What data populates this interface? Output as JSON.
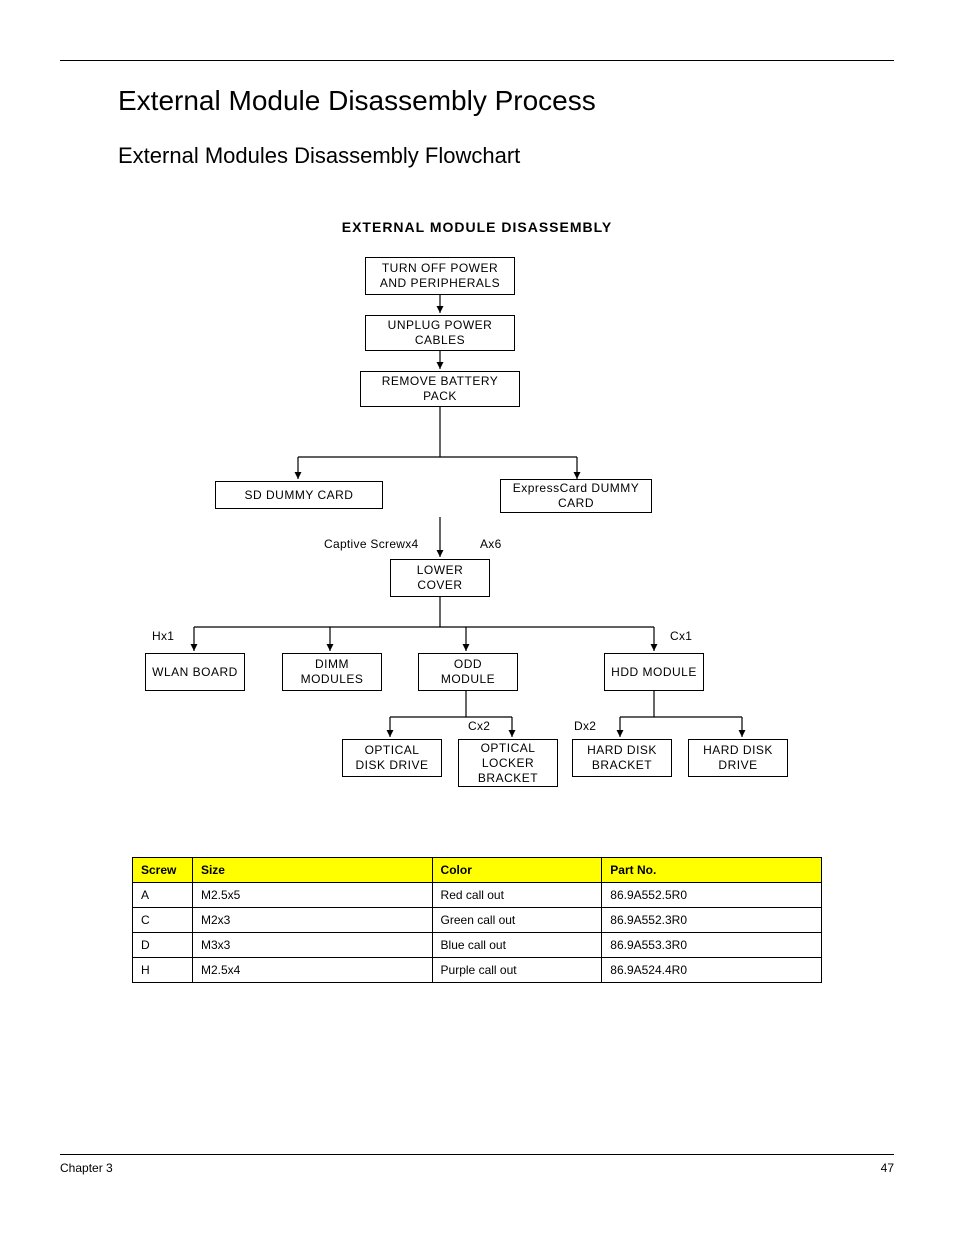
{
  "header": {
    "title": "External Module Disassembly Process",
    "subtitle": "External Modules Disassembly Flowchart"
  },
  "diagram": {
    "title": "EXTERNAL MODULE DISASSEMBLY",
    "boxes": {
      "power_off": "TURN OFF POWER AND PERIPHERALS",
      "unplug": "UNPLUG POWER CABLES",
      "battery": "REMOVE BATTERY PACK",
      "sd_dummy": "SD DUMMY CARD",
      "express_dummy": "ExpressCard DUMMY CARD",
      "lower_cover": "LOWER COVER",
      "wlan": "WLAN BOARD",
      "dimm": "DIMM MODULES",
      "odd_module": "ODD MODULE",
      "hdd_module": "HDD MODULE",
      "optical_drive": "OPTICAL DISK DRIVE",
      "optical_bracket": "OPTICAL LOCKER BRACKET",
      "hdd_bracket": "HARD DISK BRACKET",
      "hdd_drive": "HARD DISK DRIVE"
    },
    "labels": {
      "captive": "Captive Screwx4",
      "ax6": "Ax6",
      "hx1": "Hx1",
      "cx1": "Cx1",
      "cx2": "Cx2",
      "dx2": "Dx2"
    }
  },
  "table": {
    "headers": {
      "screw": "Screw",
      "size": "Size",
      "color": "Color",
      "part": "Part No."
    },
    "rows": [
      {
        "screw": "A",
        "size": "M2.5x5",
        "color": "Red call out",
        "part": "86.9A552.5R0"
      },
      {
        "screw": "C",
        "size": "M2x3",
        "color": "Green call out",
        "part": "86.9A552.3R0"
      },
      {
        "screw": "D",
        "size": "M3x3",
        "color": "Blue call out",
        "part": "86.9A553.3R0"
      },
      {
        "screw": "H",
        "size": "M2.5x4",
        "color": "Purple call out",
        "part": "86.9A524.4R0"
      }
    ]
  },
  "footer": {
    "left": "Chapter 3",
    "right": "47"
  }
}
